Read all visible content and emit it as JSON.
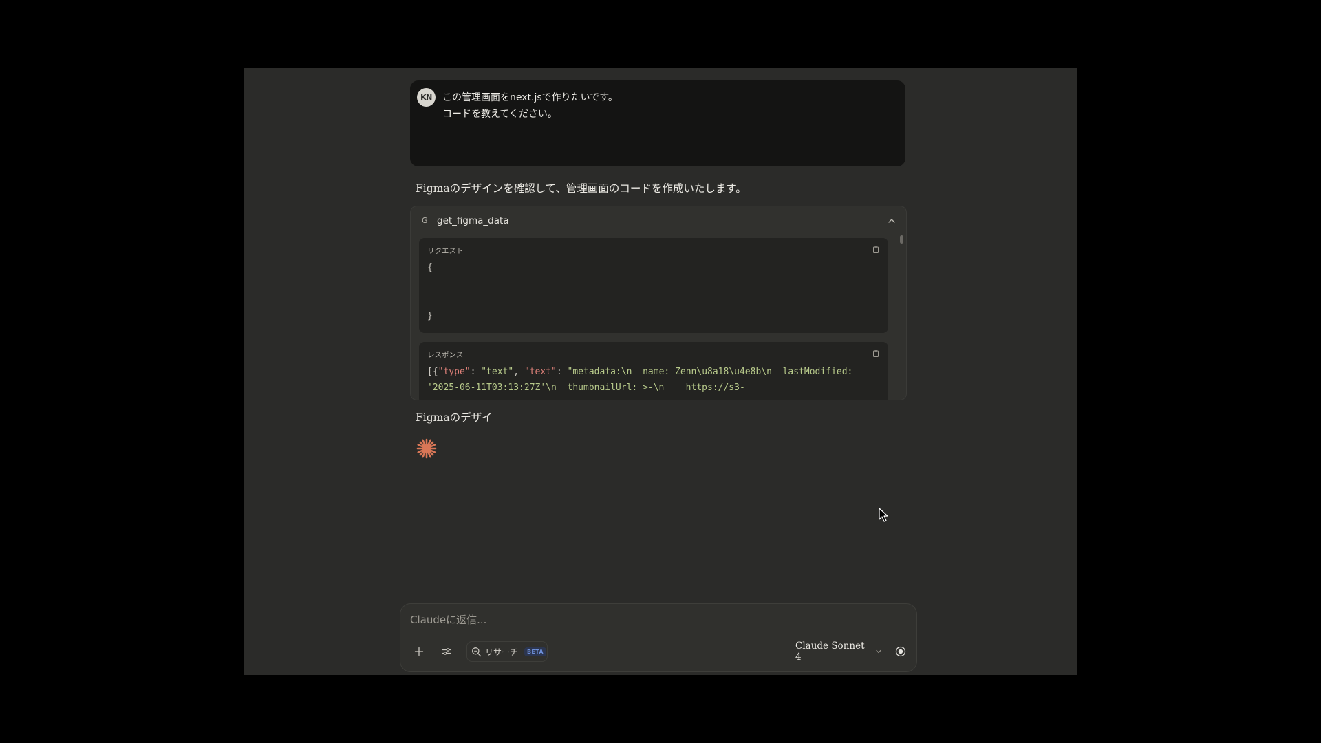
{
  "user_message": {
    "avatar_initials": "KN",
    "line1": "この管理画面をnext.jsで作りたいです。",
    "line2": "コードを教えてください。"
  },
  "assistant": {
    "intro": "Figmaのデザインを確認して、管理画面のコードを作成いたします。",
    "partial": "Figmaのデザイ"
  },
  "tool_call": {
    "icon_letter": "G",
    "name": "get_figma_data",
    "request": {
      "label": "リクエスト",
      "open_brace": "{",
      "close_brace": "}"
    },
    "response": {
      "label": "レスポンス",
      "line1_open": "[{",
      "line1_key1": "\"type\"",
      "line1_sep1": ": ",
      "line1_val1": "\"text\"",
      "line1_sep2": ", ",
      "line1_key2": "\"text\"",
      "line1_sep3": ": ",
      "line1_val2": "\"metadata:\\n  name: Zenn\\u8a18\\u4e8b\\n  lastModified:",
      "line2": "'2025-06-11T03:13:27Z'\\n  thumbnailUrl: >-\\n    https://s3-"
    }
  },
  "composer": {
    "placeholder": "Claudeに返信...",
    "research_label": "リサーチ",
    "beta_badge": "BETA",
    "model_name": "Claude Sonnet 4"
  },
  "colors": {
    "background": "#2b2b29",
    "user_bubble": "#141413",
    "accent_spark": "#d97757",
    "beta_text": "#6d8fd8"
  },
  "icons": {
    "plus": "plus-icon",
    "tune": "sliders-icon",
    "research": "search-icon",
    "chevron": "chevron-down-icon",
    "voice": "record-icon",
    "copy": "copy-icon",
    "collapse": "chevron-up-icon"
  }
}
